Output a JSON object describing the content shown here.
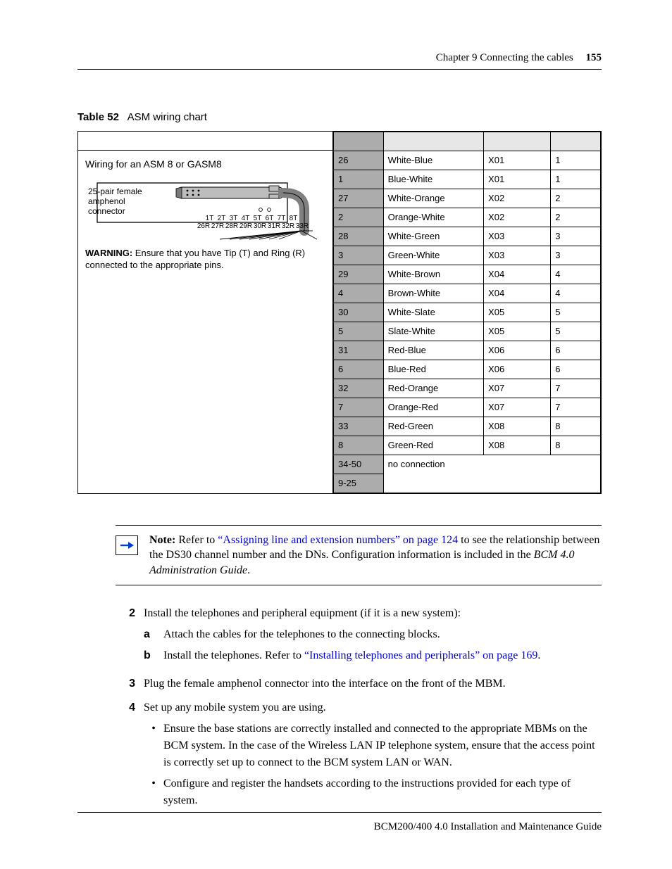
{
  "header": {
    "chapter": "Chapter 9  Connecting the cables",
    "page_number": "155"
  },
  "table52": {
    "caption_label": "Table 52",
    "caption_text": "ASM wiring chart",
    "left_title": "Wiring for an ASM 8 or GASM8",
    "connector_label_1": "25-pair female",
    "connector_label_2": "amphenol",
    "connector_label_3": "connector",
    "tip_labels": [
      "1T",
      "2T",
      "3T",
      "4T",
      "5T",
      "6T",
      "7T",
      "8T"
    ],
    "ring_labels": [
      "26R",
      "27R",
      "28R",
      "29R",
      "30R",
      "31R",
      "32R",
      "33R"
    ],
    "warning_label": "WARNING:",
    "warning_text": "Ensure that you have Tip (T) and Ring (R) connected to the appropriate pins.",
    "rows": [
      {
        "pin": "26",
        "color": "White-Blue",
        "aux": "X01",
        "port": "1"
      },
      {
        "pin": "1",
        "color": "Blue-White",
        "aux": "X01",
        "port": "1"
      },
      {
        "pin": "27",
        "color": "White-Orange",
        "aux": "X02",
        "port": "2"
      },
      {
        "pin": "2",
        "color": "Orange-White",
        "aux": "X02",
        "port": "2"
      },
      {
        "pin": "28",
        "color": "White-Green",
        "aux": "X03",
        "port": "3"
      },
      {
        "pin": "3",
        "color": "Green-White",
        "aux": "X03",
        "port": "3"
      },
      {
        "pin": "29",
        "color": "White-Brown",
        "aux": "X04",
        "port": "4"
      },
      {
        "pin": "4",
        "color": "Brown-White",
        "aux": "X04",
        "port": "4"
      },
      {
        "pin": "30",
        "color": "White-Slate",
        "aux": "X05",
        "port": "5"
      },
      {
        "pin": "5",
        "color": "Slate-White",
        "aux": "X05",
        "port": "5"
      },
      {
        "pin": "31",
        "color": "Red-Blue",
        "aux": "X06",
        "port": "6"
      },
      {
        "pin": "6",
        "color": "Blue-Red",
        "aux": "X06",
        "port": "6"
      },
      {
        "pin": "32",
        "color": "Red-Orange",
        "aux": "X07",
        "port": "7"
      },
      {
        "pin": "7",
        "color": "Orange-Red",
        "aux": "X07",
        "port": "7"
      },
      {
        "pin": "33",
        "color": "Red-Green",
        "aux": "X08",
        "port": "8"
      },
      {
        "pin": "8",
        "color": "Green-Red",
        "aux": "X08",
        "port": "8"
      }
    ],
    "noconn_left_1": "34-50",
    "noconn_left_2": "9-25",
    "noconn_text": "no connection"
  },
  "note": {
    "label": "Note:",
    "pre": " Refer to ",
    "link": "“Assigning line and extension numbers” on page 124",
    "post": " to see the relationship between the DS30 channel number and the DNs. Configuration information is included in the ",
    "guide": "BCM 4.0 Administration Guide",
    "period": "."
  },
  "steps": {
    "s2": {
      "num": "2",
      "text": "Install the telephones and peripheral equipment (if it is a new system):",
      "a_letter": "a",
      "a_text": "Attach the cables for the telephones to the connecting blocks.",
      "b_letter": "b",
      "b_pre": "Install the telephones. Refer to ",
      "b_link": "“Installing telephones and peripherals” on page 169",
      "b_post": "."
    },
    "s3": {
      "num": "3",
      "text": "Plug the female amphenol connector into the interface on the front of the MBM."
    },
    "s4": {
      "num": "4",
      "text": "Set up any mobile system you are using.",
      "bullet1": "Ensure the base stations are correctly installed and connected to the appropriate MBMs on the BCM system. In the case of the Wireless LAN IP telephone system, ensure that the access point is correctly set up to connect to the BCM system LAN or WAN.",
      "bullet2": "Configure and register the handsets according to the instructions provided for each type of system."
    }
  },
  "footer": {
    "text": "BCM200/400 4.0 Installation and Maintenance Guide"
  }
}
